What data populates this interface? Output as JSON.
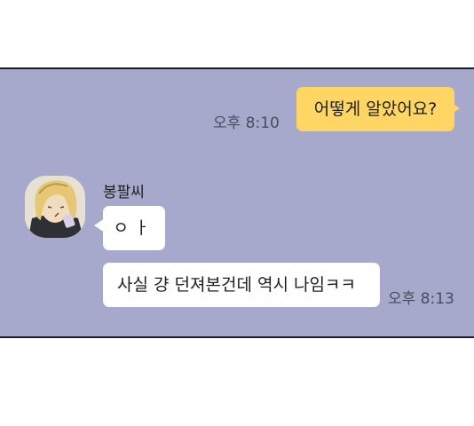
{
  "chat": {
    "messages": [
      {
        "side": "me",
        "text": "어떻게 알았어요?",
        "time": "오후 8:10"
      },
      {
        "side": "other",
        "text": "ㅇㅏ"
      },
      {
        "side": "other",
        "text": "사실 걍 던져본건데 역시 나임ㅋㅋ",
        "time": "오후 8:13"
      }
    ],
    "sender_name": "봉팔씨",
    "avatar_icon": "profile-avatar"
  },
  "colors": {
    "panel_background": "#a7a9cc",
    "my_bubble": "#ffd664",
    "their_bubble": "#ffffff"
  }
}
